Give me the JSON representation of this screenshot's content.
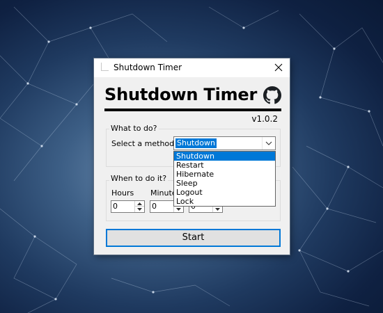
{
  "window": {
    "title": "Shutdown Timer"
  },
  "header": {
    "title": "Shutdown Timer",
    "version": "v1.0.2",
    "github_icon": "github-icon"
  },
  "what_group": {
    "label": "What to do?",
    "method_label": "Select a method:",
    "selected_method": "Shutdown",
    "options": [
      "Shutdown",
      "Restart",
      "Hibernate",
      "Sleep",
      "Logout",
      "Lock"
    ]
  },
  "when_group": {
    "label": "When to do it?",
    "hours_label": "Hours",
    "minutes_label": "Minutes",
    "hours_value": "0",
    "minutes_value": "0",
    "seconds_value": "0"
  },
  "start_label": "Start",
  "colors": {
    "accent": "#0078d7",
    "window_bg": "#f0f0f0"
  }
}
